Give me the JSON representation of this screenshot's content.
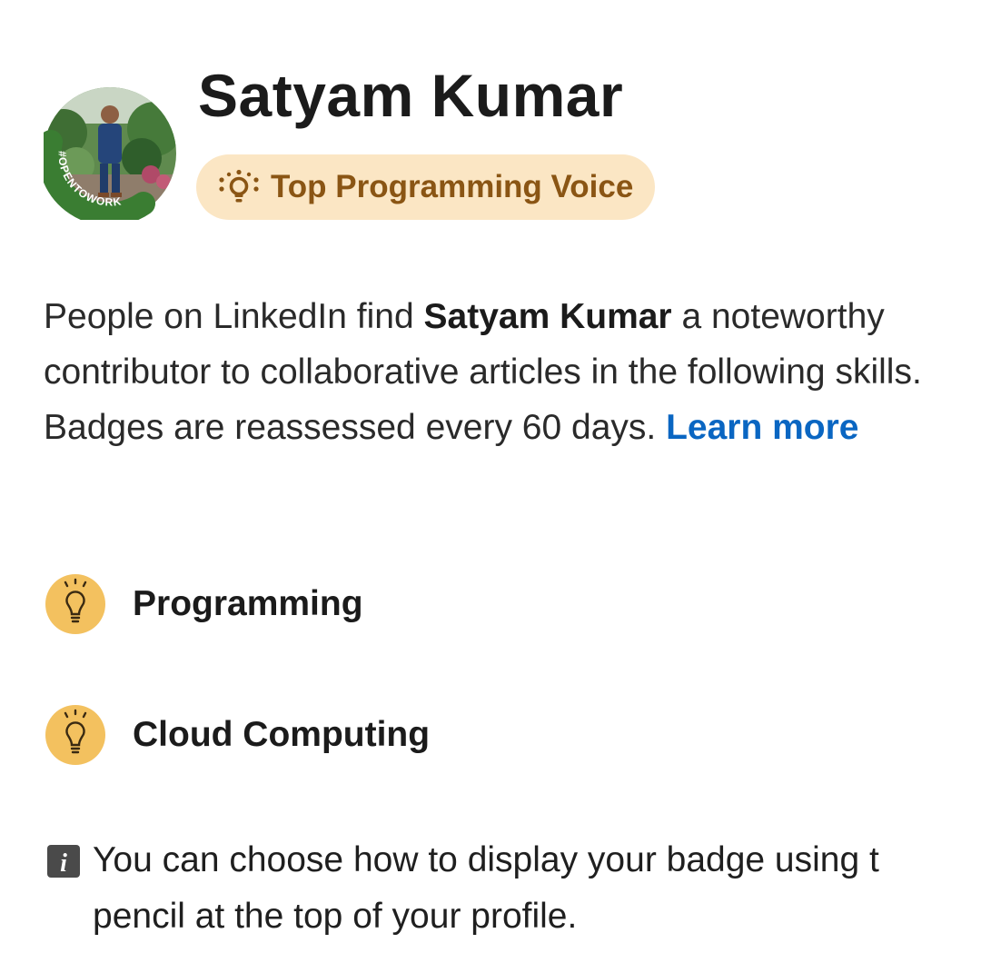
{
  "profile": {
    "name": "Satyam Kumar",
    "avatar_frame_text": "#OPENTOWORK",
    "avatar_frame_color": "#3a7d32"
  },
  "voice_badge": {
    "icon": "lightbulb-rays-icon",
    "label": "Top Programming Voice",
    "background": "#fbe6c4",
    "text_color": "#8a5514"
  },
  "description": {
    "prefix": "People on LinkedIn find ",
    "name": "Satyam Kumar",
    "suffix": " a noteworthy contributor to collaborative articles in the following skills. Badges are reassessed every 60 days. ",
    "link_label": "Learn more",
    "link_color": "#0a66c2"
  },
  "skills": [
    {
      "icon": "lightbulb-badge-icon",
      "label": "Programming"
    },
    {
      "icon": "lightbulb-badge-icon",
      "label": "Cloud Computing"
    }
  ],
  "skill_icon_color": "#f3c15f",
  "info_note": {
    "icon": "info-icon",
    "text": "You can choose how to display your badge using t\npencil at the top of your profile."
  }
}
